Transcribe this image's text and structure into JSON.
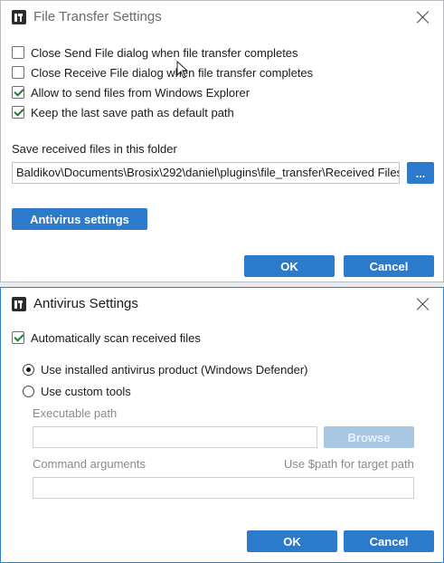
{
  "file_transfer": {
    "title": "File Transfer Settings",
    "options": [
      {
        "label": "Close Send File dialog when file transfer completes",
        "checked": false
      },
      {
        "label": "Close Receive File dialog when file transfer completes",
        "checked": false
      },
      {
        "label": "Allow to send files from Windows Explorer",
        "checked": true
      },
      {
        "label": "Keep the last save path as default path",
        "checked": true
      }
    ],
    "save_folder_label": "Save received files in this folder",
    "save_folder_value": "Baldikov\\Documents\\Brosix\\292\\daniel\\plugins\\file_transfer\\Received Files",
    "browse_label": "...",
    "antivirus_button": "Antivirus settings",
    "ok_label": "OK",
    "cancel_label": "Cancel"
  },
  "antivirus": {
    "title": "Antivirus Settings",
    "auto_scan_label": "Automatically scan received files",
    "auto_scan_checked": true,
    "radio_installed": "Use installed antivirus product (Windows Defender)",
    "radio_custom": "Use custom tools",
    "selected_radio": "installed",
    "executable_label": "Executable path",
    "executable_value": "",
    "browse_label": "Browse",
    "arguments_label": "Command arguments",
    "arguments_hint": "Use $path for target path",
    "arguments_value": "",
    "ok_label": "OK",
    "cancel_label": "Cancel"
  }
}
